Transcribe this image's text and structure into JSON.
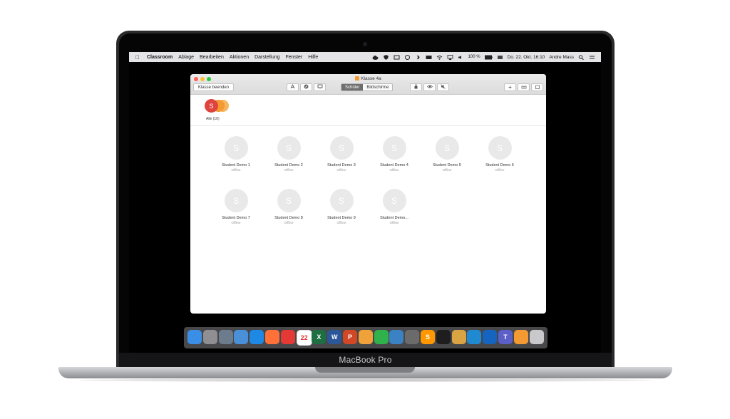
{
  "device": {
    "label": "MacBook Pro"
  },
  "menubar": {
    "app": "Classroom",
    "items": [
      "Ablage",
      "Bearbeiten",
      "Aktionen",
      "Darstellung",
      "Fenster",
      "Hilfe"
    ],
    "battery": "100 %",
    "datetime": "Do. 22. Okt. 16:10",
    "user": "Andre Mass"
  },
  "window": {
    "title": "Klasse 4a",
    "end_class_button": "Klasse beenden",
    "segments": [
      "Schüler",
      "Bildschirme"
    ],
    "active_segment": "Schüler",
    "group": {
      "initial": "S",
      "label": "Alle (10)"
    }
  },
  "students": [
    {
      "initial": "S",
      "name": "Student Demo 1",
      "status": "Offline"
    },
    {
      "initial": "S",
      "name": "Student Demo 2",
      "status": "Offline"
    },
    {
      "initial": "S",
      "name": "Student Demo 3",
      "status": "Offline"
    },
    {
      "initial": "S",
      "name": "Student Demo 4",
      "status": "Offline"
    },
    {
      "initial": "S",
      "name": "Student Demo 5",
      "status": "Offline"
    },
    {
      "initial": "S",
      "name": "Student Demo 6",
      "status": "Offline"
    },
    {
      "initial": "S",
      "name": "Student Demo 7",
      "status": "Offline"
    },
    {
      "initial": "S",
      "name": "Student Demo 8",
      "status": "Offline"
    },
    {
      "initial": "S",
      "name": "Student Demo 9",
      "status": "Offline"
    },
    {
      "initial": "S",
      "name": "Student Demo...",
      "status": "Offline"
    }
  ],
  "dock": {
    "apps": [
      {
        "icon": "finder-icon",
        "color": "#3a8ee6"
      },
      {
        "icon": "system-preferences-icon",
        "color": "#8e8e93"
      },
      {
        "icon": "launchpad-icon",
        "color": "#6d7c8c"
      },
      {
        "icon": "preview-icon",
        "color": "#4a90d9"
      },
      {
        "icon": "safari-icon",
        "color": "#1e88e5"
      },
      {
        "icon": "firefox-icon",
        "color": "#ff7139"
      },
      {
        "icon": "chrome-icon",
        "color": "#e53935"
      },
      {
        "icon": "calendar-icon",
        "color": "#ffffff",
        "text": "22"
      },
      {
        "icon": "excel-icon",
        "color": "#1d6f42",
        "text": "X"
      },
      {
        "icon": "word-icon",
        "color": "#2b579a",
        "text": "W"
      },
      {
        "icon": "powerpoint-icon",
        "color": "#d24726",
        "text": "P"
      },
      {
        "icon": "pages-icon",
        "color": "#f0a23a"
      },
      {
        "icon": "numbers-icon",
        "color": "#2fb24c"
      },
      {
        "icon": "keynote-icon",
        "color": "#3b82c4"
      },
      {
        "icon": "screenshot-app-icon",
        "color": "#6b6b6b"
      },
      {
        "icon": "sublime-text-icon",
        "color": "#ff9800",
        "text": "S"
      },
      {
        "icon": "terminal-icon",
        "color": "#1e1e1e"
      },
      {
        "icon": "notes-app-icon",
        "color": "#d9a441"
      },
      {
        "icon": "vscode-icon",
        "color": "#1f8ad2"
      },
      {
        "icon": "maps-pin-icon",
        "color": "#1565c0"
      },
      {
        "icon": "teams-icon",
        "color": "#5b5fc7",
        "text": "T"
      },
      {
        "icon": "classroom-icon",
        "color": "#f39a32"
      },
      {
        "icon": "trash-icon",
        "color": "#c9c9cc"
      }
    ]
  },
  "colors": {
    "group_primary": "#e0443e",
    "group_secondary": "#f39a32",
    "accent_segment": "#6e6e6e"
  }
}
